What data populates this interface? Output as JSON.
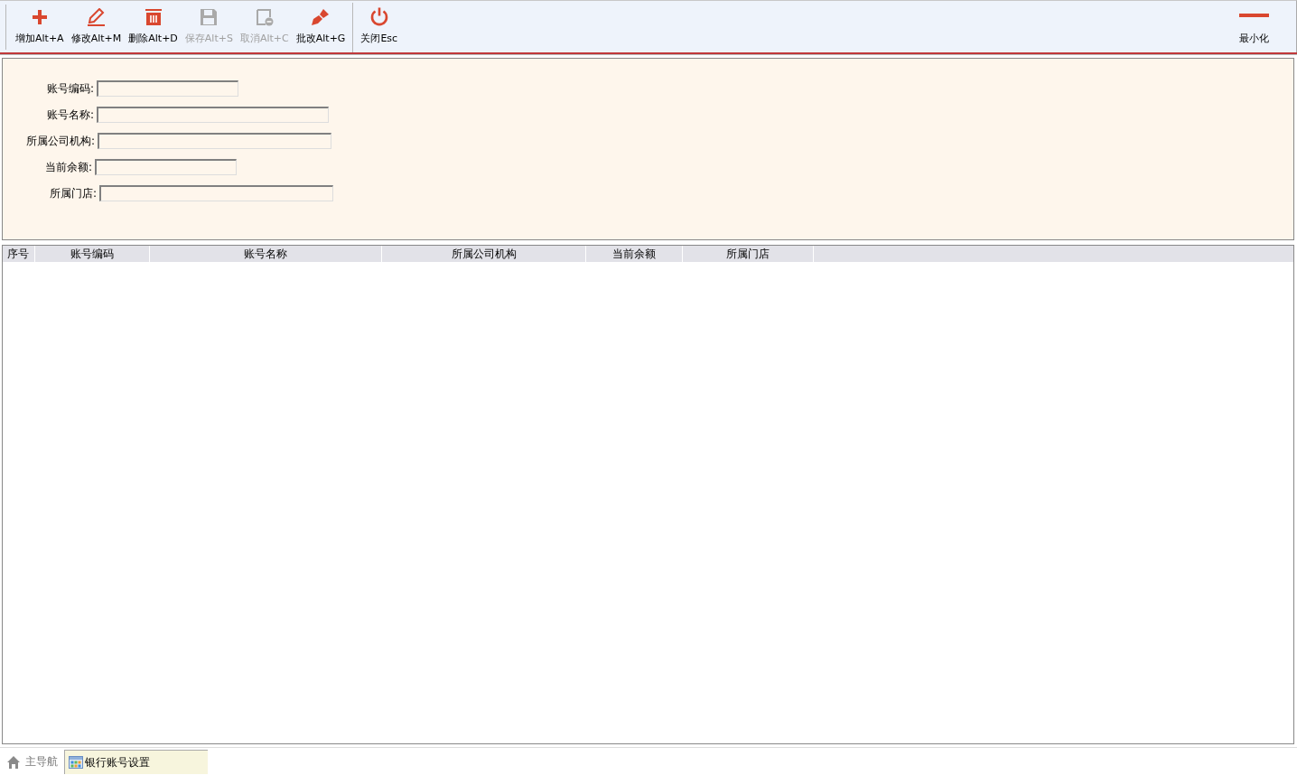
{
  "toolbar": {
    "buttons": [
      {
        "kind": "add",
        "label": "增加Alt+A",
        "disabled": false
      },
      {
        "kind": "edit",
        "label": "修改Alt+M",
        "disabled": false
      },
      {
        "kind": "delete",
        "label": "删除Alt+D",
        "disabled": false
      },
      {
        "kind": "save",
        "label": "保存Alt+S",
        "disabled": true
      },
      {
        "kind": "cancel",
        "label": "取消Alt+C",
        "disabled": true
      },
      {
        "kind": "approve",
        "label": "批改Alt+G",
        "disabled": false
      },
      {
        "kind": "close",
        "label": "关闭Esc",
        "disabled": false
      }
    ],
    "minimize": {
      "label": "最小化"
    }
  },
  "form": {
    "fields": [
      {
        "label": "账号编码:"
      },
      {
        "label": "账号名称:"
      },
      {
        "label": "所属公司机构:"
      },
      {
        "label": "当前余额:"
      },
      {
        "label": "所属门店:"
      }
    ]
  },
  "table": {
    "columns": [
      "序号",
      "账号编码",
      "账号名称",
      "所属公司机构",
      "当前余额",
      "所属门店"
    ]
  },
  "tabs": [
    {
      "kind": "home",
      "label": "主导航",
      "selected": false
    },
    {
      "kind": "window",
      "label": "银行账号设置",
      "selected": true
    }
  ]
}
